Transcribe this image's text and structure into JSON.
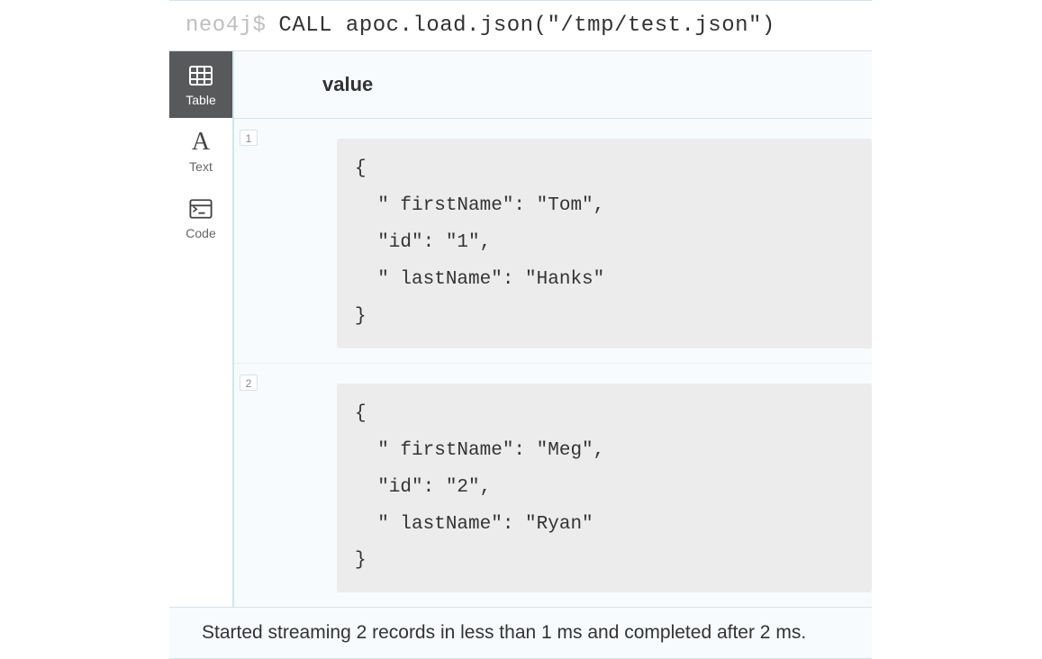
{
  "query": {
    "prompt": "neo4j$",
    "text": "CALL apoc.load.json(\"/tmp/test.json\")"
  },
  "viewTabs": [
    {
      "id": "table",
      "label": "Table",
      "active": true
    },
    {
      "id": "text",
      "label": "Text",
      "active": false
    },
    {
      "id": "code",
      "label": "Code",
      "active": false
    }
  ],
  "table": {
    "columnHeader": "value",
    "rows": [
      {
        "num": "1",
        "value": "{\n  \" firstName\": \"Tom\",\n  \"id\": \"1\",\n  \" lastName\": \"Hanks\"\n}"
      },
      {
        "num": "2",
        "value": "{\n  \" firstName\": \"Meg\",\n  \"id\": \"2\",\n  \" lastName\": \"Ryan\"\n}"
      }
    ]
  },
  "status": "Started streaming 2 records in less than 1 ms and completed after 2 ms."
}
